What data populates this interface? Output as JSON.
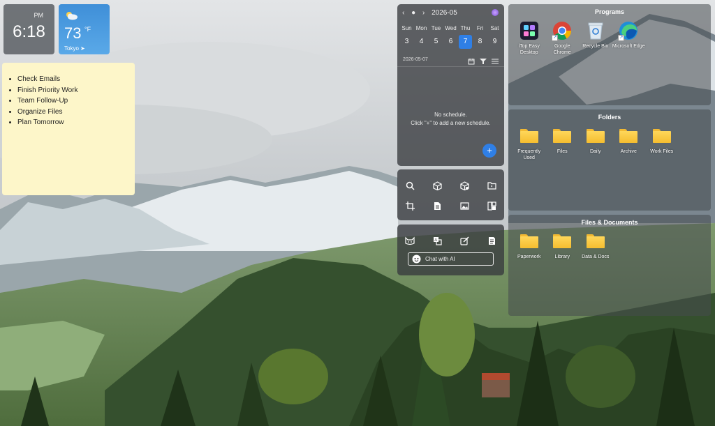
{
  "clock": {
    "ampm": "PM",
    "time": "6:18"
  },
  "weather": {
    "temp": "73",
    "unit": "°F",
    "city": "Tokyo"
  },
  "note": {
    "items": [
      "Check Emails",
      "Finish Priority Work",
      "Team Follow-Up",
      "Organize Files",
      "Plan Tomorrow"
    ]
  },
  "calendar": {
    "month": "2026-05",
    "weekdays": [
      "Sun",
      "Mon",
      "Tue",
      "Wed",
      "Thu",
      "Fri",
      "Sat"
    ],
    "dates": [
      "3",
      "4",
      "5",
      "6",
      "7",
      "8",
      "9"
    ],
    "today_index": 4,
    "selected_date": "2026-05-07",
    "empty_line1": "No schedule.",
    "empty_line2": "Click \"+\" to add a new schedule.",
    "add_label": "+"
  },
  "tools": {
    "row1": [
      "search-icon",
      "cube-icon",
      "box-icon",
      "folder-arrow-icon"
    ],
    "row2": [
      "crop-icon",
      "document-icon",
      "image-icon",
      "layout-icon"
    ]
  },
  "ai": {
    "row": [
      "cat-icon",
      "translate-icon",
      "edit-icon",
      "notes-icon"
    ],
    "chat_label": "Chat with AI"
  },
  "programs": {
    "title": "Programs",
    "items": [
      {
        "label": "iTop Easy Desktop",
        "icon": "itop-icon"
      },
      {
        "label": "Google Chrome",
        "icon": "chrome-icon"
      },
      {
        "label": "Recycle Bin",
        "icon": "recycle-bin-icon"
      },
      {
        "label": "Microsoft Edge",
        "icon": "edge-icon"
      }
    ]
  },
  "folders": {
    "title": "Folders",
    "items": [
      {
        "label": "Frequently Used"
      },
      {
        "label": "Files"
      },
      {
        "label": "Daily"
      },
      {
        "label": "Archive"
      },
      {
        "label": "Work Files"
      }
    ]
  },
  "documents": {
    "title": "Files & Documents",
    "items": [
      {
        "label": "Paperwork"
      },
      {
        "label": "Library"
      },
      {
        "label": "Data & Docs"
      }
    ]
  },
  "colors": {
    "accent": "#2f7fe6",
    "note_bg": "#fdf6c9",
    "folder": "#f5bd2f"
  }
}
